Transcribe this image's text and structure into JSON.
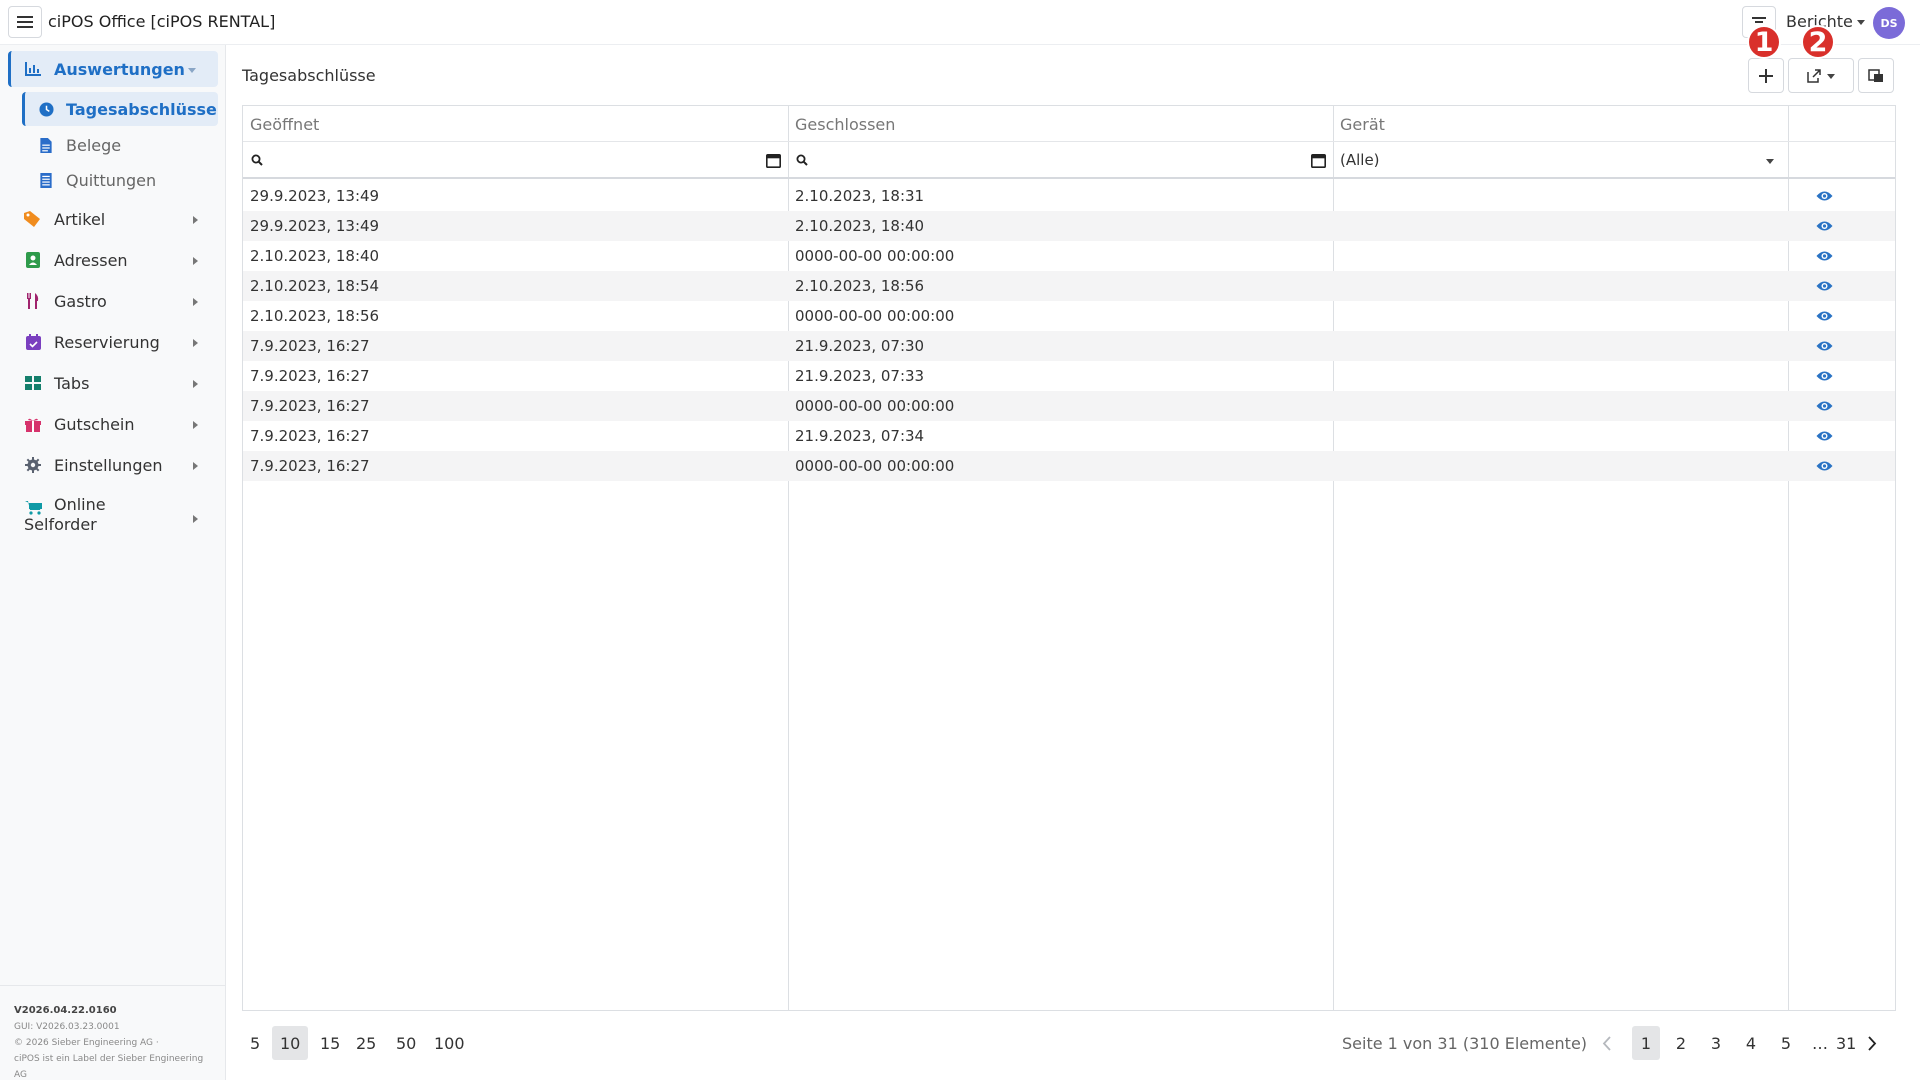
{
  "app": {
    "title": "ciPOS Office [ciPOS RENTAL]",
    "reports_menu": "Berichte",
    "avatar_initials": "DS",
    "annotation_badges": [
      "1",
      "2"
    ]
  },
  "sidebar": {
    "items": [
      {
        "label": "Auswertungen",
        "icon": "chart-icon",
        "active": true
      },
      {
        "label": "Artikel",
        "icon": "tag-icon"
      },
      {
        "label": "Adressen",
        "icon": "address-book-icon"
      },
      {
        "label": "Gastro",
        "icon": "utensils-icon"
      },
      {
        "label": "Reservierung",
        "icon": "calendar-check-icon"
      },
      {
        "label": "Tabs",
        "icon": "grid-icon"
      },
      {
        "label": "Gutschein",
        "icon": "gift-icon"
      },
      {
        "label": "Einstellungen",
        "icon": "gear-icon"
      },
      {
        "label": "Online\nSelforder",
        "label_line1": "Online",
        "label_line2": "Selforder",
        "icon": "cart-icon"
      }
    ],
    "sub_items": [
      {
        "label": "Tagesabschlüsse",
        "icon": "clock-icon",
        "active": true
      },
      {
        "label": "Belege",
        "icon": "document-icon"
      },
      {
        "label": "Quittungen",
        "icon": "receipt-icon"
      }
    ],
    "footer": {
      "version": "V2026.04.22.0160",
      "gui_version": "GUI: V2026.03.23.0001",
      "copyright": "© 2026 Sieber Engineering AG ·",
      "label_note": "ciPOS ist ein Label der Sieber Engineering AG"
    }
  },
  "main": {
    "page_title": "Tagesabschlüsse",
    "table": {
      "columns": [
        "Geöffnet",
        "Geschlossen",
        "Gerät",
        ""
      ],
      "filters": {
        "opened": "",
        "closed": "",
        "device": "(Alle)"
      },
      "rows": [
        {
          "opened": "29.9.2023, 13:49",
          "closed": "2.10.2023, 18:31",
          "device": ""
        },
        {
          "opened": "29.9.2023, 13:49",
          "closed": "2.10.2023, 18:40",
          "device": ""
        },
        {
          "opened": "2.10.2023, 18:40",
          "closed": "0000-00-00 00:00:00",
          "device": ""
        },
        {
          "opened": "2.10.2023, 18:54",
          "closed": "2.10.2023, 18:56",
          "device": ""
        },
        {
          "opened": "2.10.2023, 18:56",
          "closed": "0000-00-00 00:00:00",
          "device": ""
        },
        {
          "opened": "7.9.2023, 16:27",
          "closed": "21.9.2023, 07:30",
          "device": ""
        },
        {
          "opened": "7.9.2023, 16:27",
          "closed": "21.9.2023, 07:33",
          "device": ""
        },
        {
          "opened": "7.9.2023, 16:27",
          "closed": "0000-00-00 00:00:00",
          "device": ""
        },
        {
          "opened": "7.9.2023, 16:27",
          "closed": "21.9.2023, 07:34",
          "device": ""
        },
        {
          "opened": "7.9.2023, 16:27",
          "closed": "0000-00-00 00:00:00",
          "device": ""
        }
      ]
    },
    "pager": {
      "page_sizes": [
        "5",
        "10",
        "15",
        "25",
        "50",
        "100"
      ],
      "selected_size": "10",
      "info": "Seite 1 von 31 (310 Elemente)",
      "pages": [
        "1",
        "2",
        "3",
        "4",
        "5",
        "…",
        "31"
      ],
      "current_page": "1"
    }
  },
  "colors": {
    "accent": "#1f6fc5",
    "avatar": "#7b6bd8",
    "badge": "#d9302b",
    "row_alt": "#f4f4f5"
  }
}
